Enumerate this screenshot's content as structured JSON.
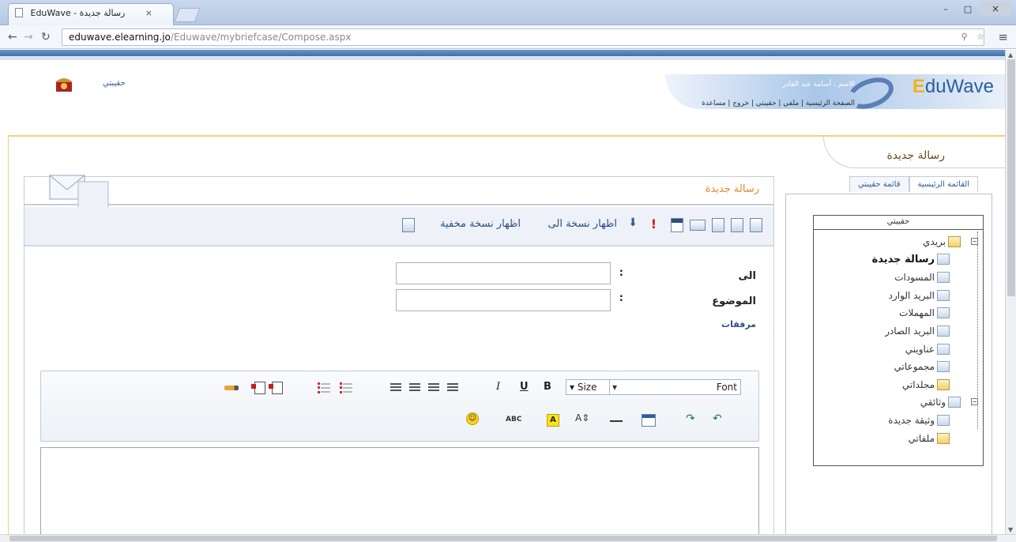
{
  "browser": {
    "tab_title": "EduWave - رسالة جديدة",
    "tab_close": "×",
    "url_domain": "eduwave.elearning.jo",
    "url_path": "/Eduwave/mybriefcase/Compose.aspx",
    "win_minimize": "–",
    "win_maximize": "□",
    "win_close": "×"
  },
  "header": {
    "logo_text": "duWave",
    "logo_letter": "E",
    "user_greeting": "الاسم : أسامة عبد القادر",
    "links": "الصفحة الرئيسية  |  ملفي  |  حقيبتي  |  خروج  |  مساعدة",
    "site_link": "حقيبتي"
  },
  "page": {
    "title": "رسالة جديدة"
  },
  "side": {
    "tabs": [
      "القائمة الرئيسية",
      "قائمة حقيبتي"
    ],
    "tree_title": "حقيبتي",
    "tree": [
      {
        "label": "بريدي",
        "level": 1,
        "expander": "−",
        "bold": false,
        "folder": true
      },
      {
        "label": "رسالة جديدة",
        "level": 2,
        "bold": true,
        "folder": false
      },
      {
        "label": "المسودات",
        "level": 2,
        "bold": false,
        "folder": false
      },
      {
        "label": "البريد الوارد",
        "level": 2,
        "bold": false,
        "folder": false
      },
      {
        "label": "المهملات",
        "level": 2,
        "bold": false,
        "folder": false
      },
      {
        "label": "البريد الصادر",
        "level": 2,
        "bold": false,
        "folder": false
      },
      {
        "label": "عناويني",
        "level": 2,
        "bold": false,
        "folder": false
      },
      {
        "label": "مجموعاتي",
        "level": 2,
        "bold": false,
        "folder": false
      },
      {
        "label": "مجلداتي",
        "level": 2,
        "bold": false,
        "folder": true
      },
      {
        "label": "وثائقي",
        "level": 1,
        "expander": "−",
        "bold": false,
        "folder": false
      },
      {
        "label": "وثيقة جديدة",
        "level": 2,
        "bold": false,
        "folder": false
      },
      {
        "label": "ملفاتي",
        "level": 2,
        "bold": false,
        "folder": true
      }
    ]
  },
  "compose": {
    "title": "رسالة جديدة",
    "show_cc": "اظهار نسخة الى",
    "show_bcc": "اظهار نسخة مخفية",
    "priority_mark": "!",
    "to_label": "الى",
    "subject_label": "الموضوع",
    "colon": ":",
    "attachments_label": "مرفقات"
  },
  "editor": {
    "size_label": "▾ Size",
    "size_arrow": "▾",
    "font_label": "Font",
    "bold": "B",
    "underline": "U",
    "italic": "I",
    "highlight": "A",
    "fontsize": "A⇕",
    "spell": "ABC",
    "smiley": "☺",
    "undo": "↶",
    "redo": "↷"
  }
}
